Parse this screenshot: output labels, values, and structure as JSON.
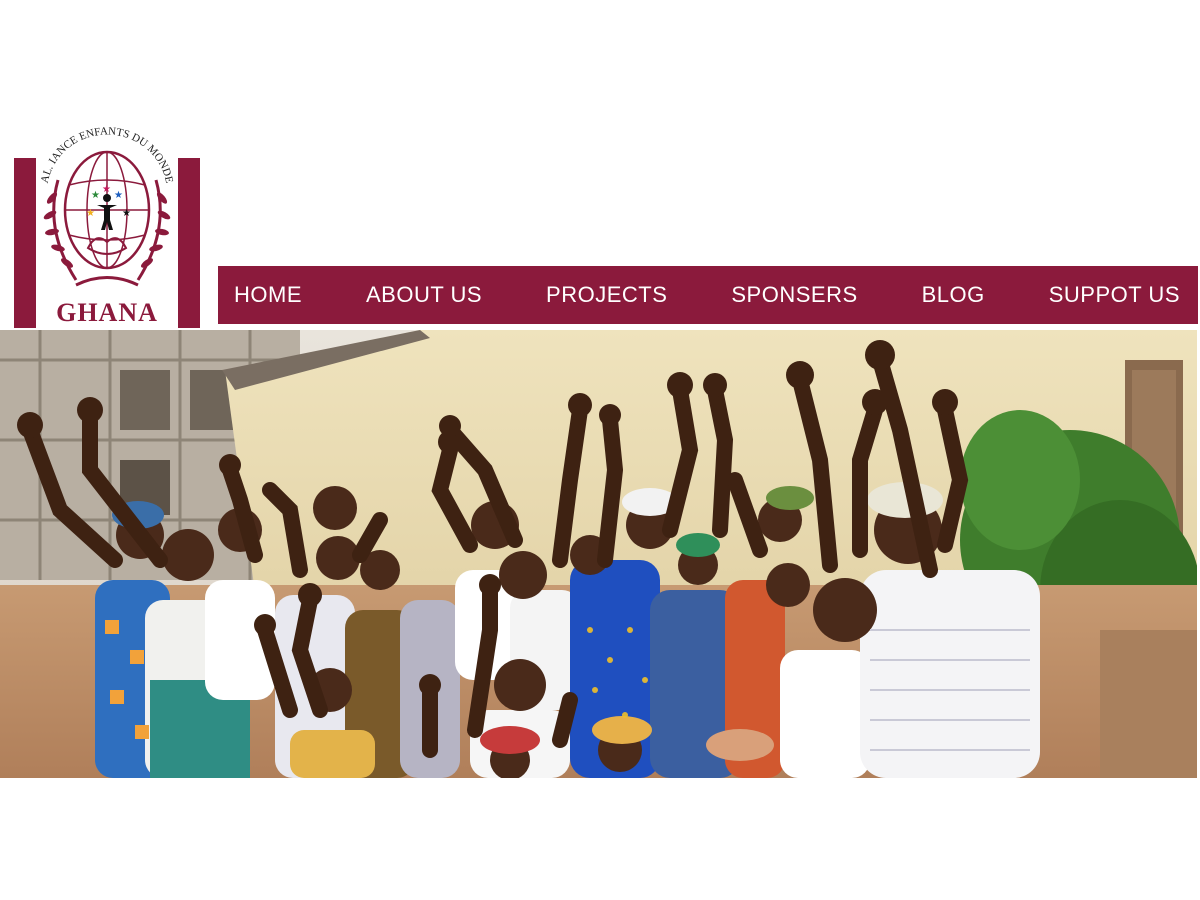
{
  "logo": {
    "arc_text": "AL. IANCE ENFANTS DU MONDE",
    "country": "GHANA",
    "brand_color": "#8b1a3c"
  },
  "nav": {
    "items": [
      {
        "label": "HOME"
      },
      {
        "label": "ABOUT US"
      },
      {
        "label": "PROJECTS"
      },
      {
        "label": "SPONSERS"
      },
      {
        "label": "BLOG"
      },
      {
        "label": "SUPPOT US"
      }
    ]
  },
  "hero": {
    "alt": "Group of cheering children in colourful wraps raising their hands in front of a building"
  }
}
